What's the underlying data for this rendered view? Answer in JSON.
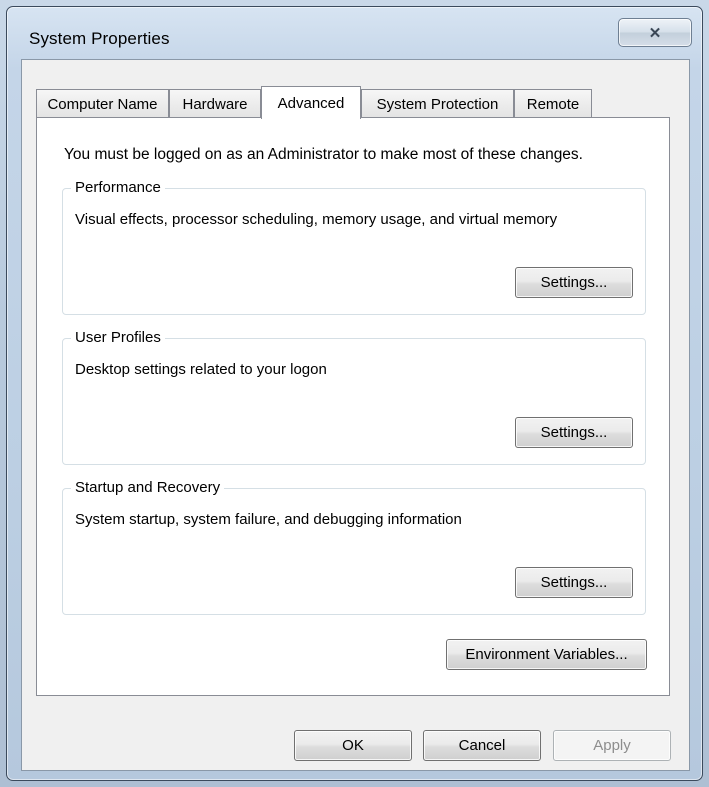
{
  "window": {
    "title": "System Properties",
    "close_glyph": "✕"
  },
  "tabs": [
    {
      "label": "Computer Name",
      "active": false
    },
    {
      "label": "Hardware",
      "active": false
    },
    {
      "label": "Advanced",
      "active": true
    },
    {
      "label": "System Protection",
      "active": false
    },
    {
      "label": "Remote",
      "active": false
    }
  ],
  "advanced": {
    "notice": "You must be logged on as an Administrator to make most of these changes.",
    "groups": [
      {
        "label": "Performance",
        "description": "Visual effects, processor scheduling, memory usage, and virtual memory",
        "button": "Settings..."
      },
      {
        "label": "User Profiles",
        "description": "Desktop settings related to your logon",
        "button": "Settings..."
      },
      {
        "label": "Startup and Recovery",
        "description": "System startup, system failure, and debugging information",
        "button": "Settings..."
      }
    ],
    "env_button": "Environment Variables..."
  },
  "footer": {
    "ok": "OK",
    "cancel": "Cancel",
    "apply": "Apply",
    "apply_enabled": false
  }
}
